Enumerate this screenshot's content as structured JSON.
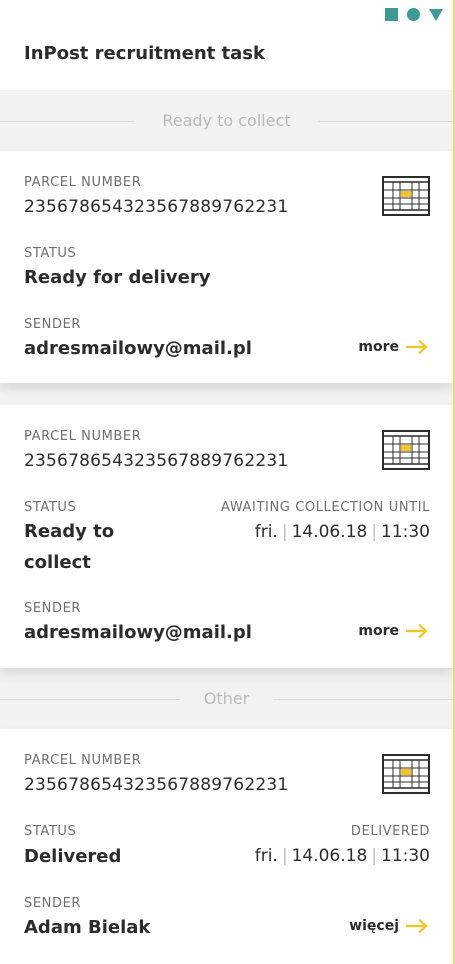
{
  "app": {
    "title": "InPost recruitment task"
  },
  "status_bar": {
    "icons": [
      "square-icon",
      "circle-icon",
      "triangle-icon"
    ],
    "accent": "#3d9b95"
  },
  "sections": {
    "ready": "Ready to collect",
    "other": "Other"
  },
  "labels": {
    "parcel_number": "PARCEL NUMBER",
    "status": "STATUS",
    "sender": "SENDER"
  },
  "cards": [
    {
      "parcel_number": "235678654323567889762231",
      "status": "Ready for delivery",
      "sender": "adresmailowy@mail.pl",
      "more": "more"
    },
    {
      "parcel_number": "235678654323567889762231",
      "status_line1": "Ready to",
      "status_line2": "collect",
      "date_label": "AWAITING COLLECTION UNTIL",
      "day": "fri.",
      "date": "14.06.18",
      "time": "11:30",
      "sender": "adresmailowy@mail.pl",
      "more": "more"
    },
    {
      "parcel_number": "235678654323567889762231",
      "status": "Delivered",
      "date_label": "DELIVERED",
      "day": "fri.",
      "date": "14.06.18",
      "time": "11:30",
      "sender": "Adam Bielak",
      "more": "więcej"
    }
  ],
  "colors": {
    "accent_yellow": "#f3c51f",
    "text": "#2c2c2c",
    "label": "#6f6f6f"
  }
}
